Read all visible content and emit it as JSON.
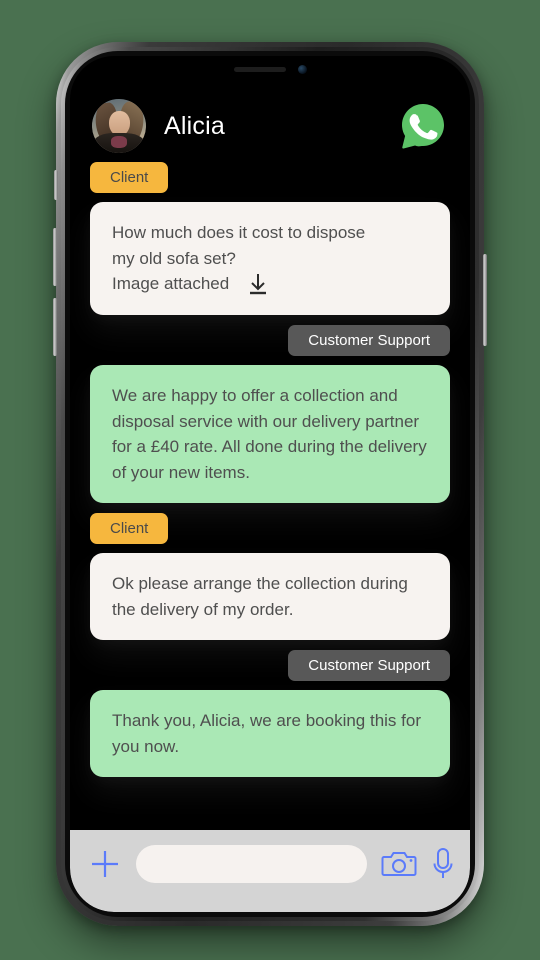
{
  "app": {
    "background_color": "#4a7150",
    "screen_background": "#000000"
  },
  "header": {
    "contact_name": "Alicia",
    "avatar_name": "alicia-avatar",
    "call_button_label": "WhatsApp call",
    "call_button_color": "#5cc367"
  },
  "conversation": [
    {
      "sender": "client",
      "badge": "Client",
      "badge_color": "#f6b73e",
      "align": "left",
      "bubble_color": "#f7f3f0",
      "lines": [
        "How much does it cost to dispose",
        "my old sofa set?"
      ],
      "attachment_label": "Image attached",
      "attachment_icon": "download-icon"
    },
    {
      "sender": "support",
      "badge": "Customer Support",
      "badge_color": "#585858",
      "align": "right",
      "bubble_color": "#aae8b5",
      "lines": [
        "We are happy to offer a collection and disposal service with our delivery partner for a £40 rate. All done during the delivery of your new items."
      ]
    },
    {
      "sender": "client",
      "badge": "Client",
      "badge_color": "#f6b73e",
      "align": "left",
      "bubble_color": "#f7f3f0",
      "lines": [
        "Ok please arrange the collection during the delivery of my order."
      ]
    },
    {
      "sender": "support",
      "badge": "Customer Support",
      "badge_color": "#585858",
      "align": "right",
      "bubble_color": "#aae8b5",
      "lines": [
        "Thank you, Alicia, we are booking this for you now."
      ]
    }
  ],
  "messages": {
    "m1_badge": "Client",
    "m1_line1": "How much does it cost to dispose",
    "m1_line2": "my old sofa set?",
    "m1_attach": "Image attached",
    "m2_badge": "Customer Support",
    "m2_text": "We are happy to offer a collection and disposal service with our delivery partner for a £40 rate. All done during the delivery of your new items.",
    "m3_badge": "Client",
    "m3_text": "Ok please arrange the collection during the delivery of my order.",
    "m4_badge": "Customer Support",
    "m4_text": "Thank you, Alicia, we are booking this for you now."
  },
  "input_bar": {
    "background_color": "#d4d4d4",
    "icon_color": "#5b7bfa",
    "add_label": "Add attachment",
    "text_value": "",
    "placeholder": "",
    "camera_label": "Camera",
    "mic_label": "Microphone"
  }
}
